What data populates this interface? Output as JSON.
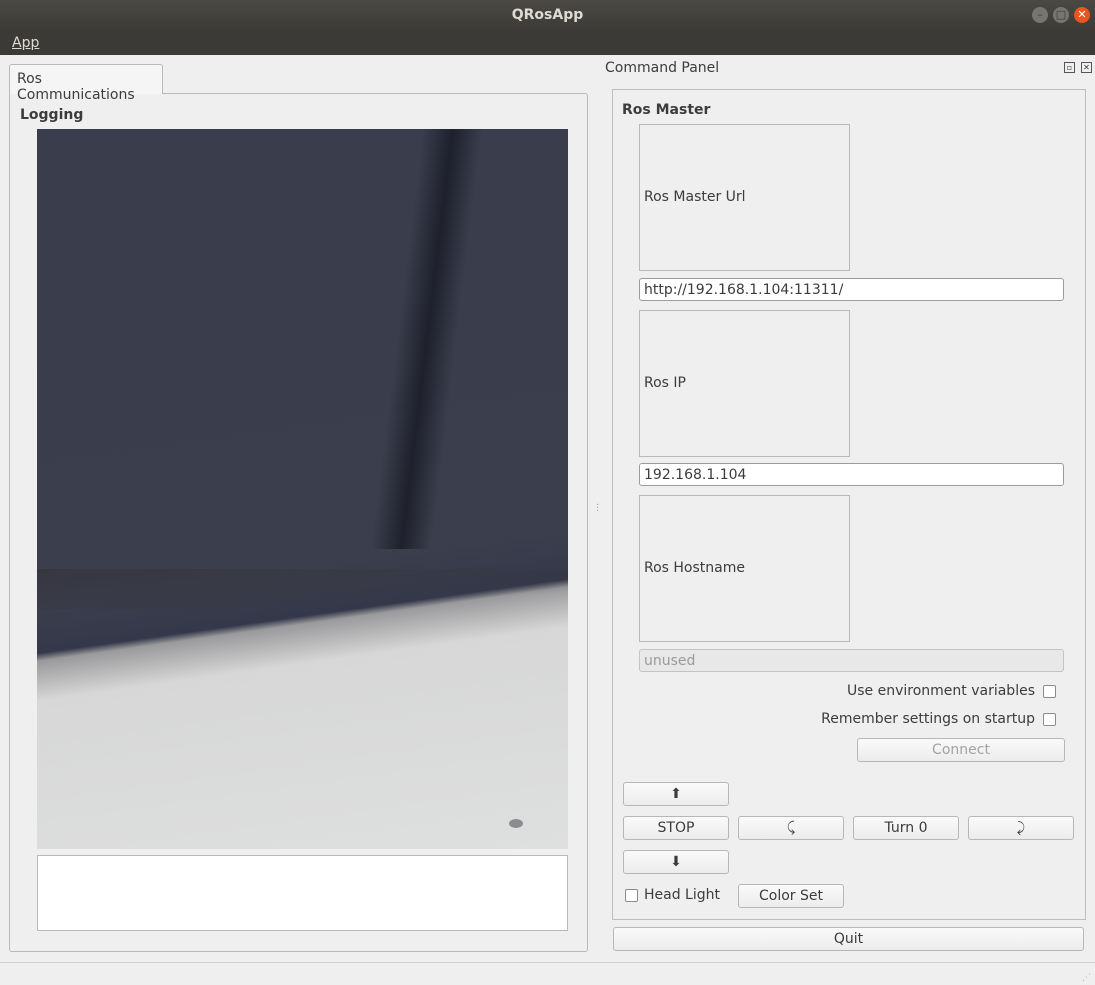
{
  "window": {
    "title": "QRosApp",
    "controls": [
      "minimize-icon",
      "maximize-icon",
      "close-icon"
    ]
  },
  "menubar": {
    "app": "App"
  },
  "left": {
    "tab": "Ros Communications",
    "logging_title": "Logging",
    "log_text": ""
  },
  "command_panel": {
    "title": "Command Panel",
    "group_title": "Ros Master",
    "master_url_label": "Ros Master Url",
    "master_url_value": "http://192.168.1.104:11311/",
    "ip_label": "Ros IP",
    "ip_value": "192.168.1.104",
    "hostname_label": "Ros Hostname",
    "hostname_value": "unused",
    "use_env": "Use environment variables",
    "remember": "Remember settings on startup",
    "connect": "Connect",
    "forward": "⬆",
    "stop": "STOP",
    "turn_left": "⤹",
    "turn_value": "Turn 0",
    "turn_right": "⤸",
    "backward": "⬇",
    "head_light": "Head Light",
    "color_set": "Color Set"
  },
  "quit": "Quit",
  "colors": {
    "titlebar": "#3b3a36",
    "close": "#e9541f",
    "background": "#efefef"
  }
}
